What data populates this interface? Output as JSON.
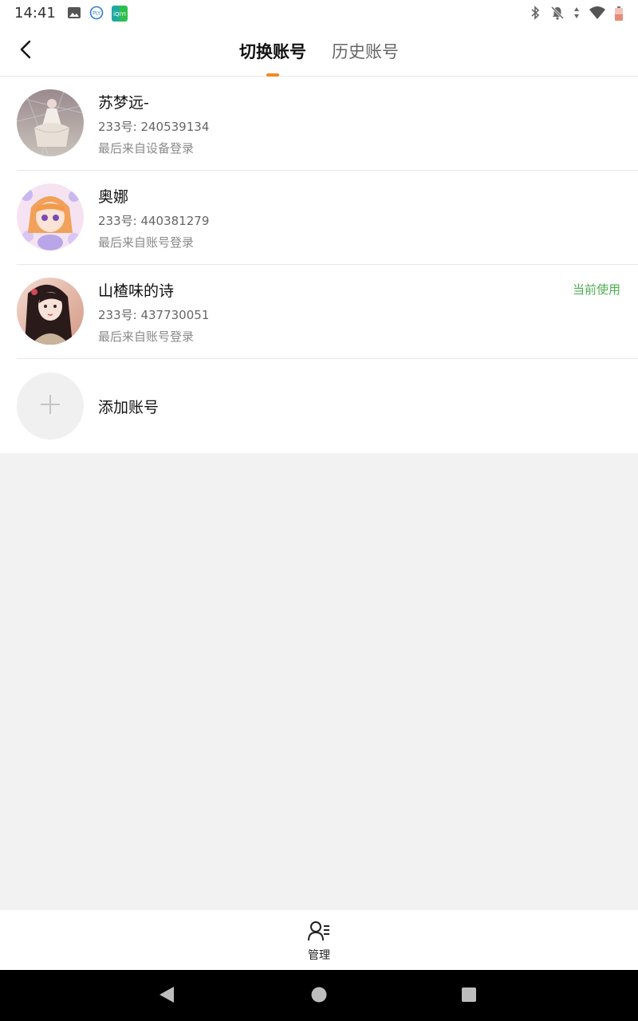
{
  "status_bar": {
    "time": "14:41",
    "left_icons": [
      "gallery-icon",
      "play-badge-icon",
      "iqiyi-app-icon"
    ],
    "right_icons": [
      "bluetooth-icon",
      "notifications-off-icon",
      "data-arrows-icon",
      "wifi-icon",
      "battery-icon"
    ]
  },
  "header": {
    "back_icon": "back-arrow-icon",
    "tabs": [
      {
        "label": "切换账号",
        "active": true
      },
      {
        "label": "历史账号",
        "active": false
      }
    ],
    "indicator_color": "#f08a24"
  },
  "accounts": [
    {
      "name": "苏梦远-",
      "uid_label": "233号:",
      "uid": "240539134",
      "login_info": "最后来自设备登录",
      "current": ""
    },
    {
      "name": "奥娜",
      "uid_label": "233号:",
      "uid": "440381279",
      "login_info": "最后来自账号登录",
      "current": ""
    },
    {
      "name": "山楂味的诗",
      "uid_label": "233号:",
      "uid": "437730051",
      "login_info": "最后来自账号登录",
      "current": "当前使用"
    }
  ],
  "add_account": {
    "label": "添加账号",
    "icon": "plus-icon"
  },
  "bottom": {
    "manage_label": "管理",
    "manage_icon": "user-manage-icon"
  },
  "nav": {
    "back_icon": "nav-back-icon",
    "home_icon": "nav-home-icon",
    "recents_icon": "nav-recents-icon"
  },
  "colors": {
    "accent": "#f08a24",
    "current_badge": "#4caf50",
    "background": "#f2f2f2"
  }
}
